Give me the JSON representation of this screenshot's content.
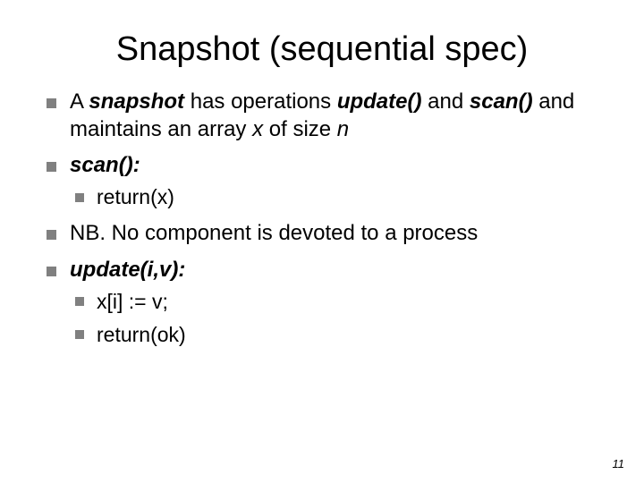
{
  "title": "Snapshot (sequential spec)",
  "b1": {
    "pre": "A ",
    "snapshot": "snapshot",
    "mid1": " has operations ",
    "update": "update()",
    "and1": " and ",
    "scan": "scan()",
    "mid2": " and maintains an array ",
    "x": "x",
    "mid3": " of size ",
    "n": "n"
  },
  "b2": {
    "label": "scan():"
  },
  "b2s": {
    "ret": "return(x)"
  },
  "b3": {
    "text": "NB. No component is devoted to a process"
  },
  "b4": {
    "label": "update(i,v):"
  },
  "b4s": {
    "l1": "x[i] := v;",
    "l2": "return(ok)"
  },
  "page": "11"
}
